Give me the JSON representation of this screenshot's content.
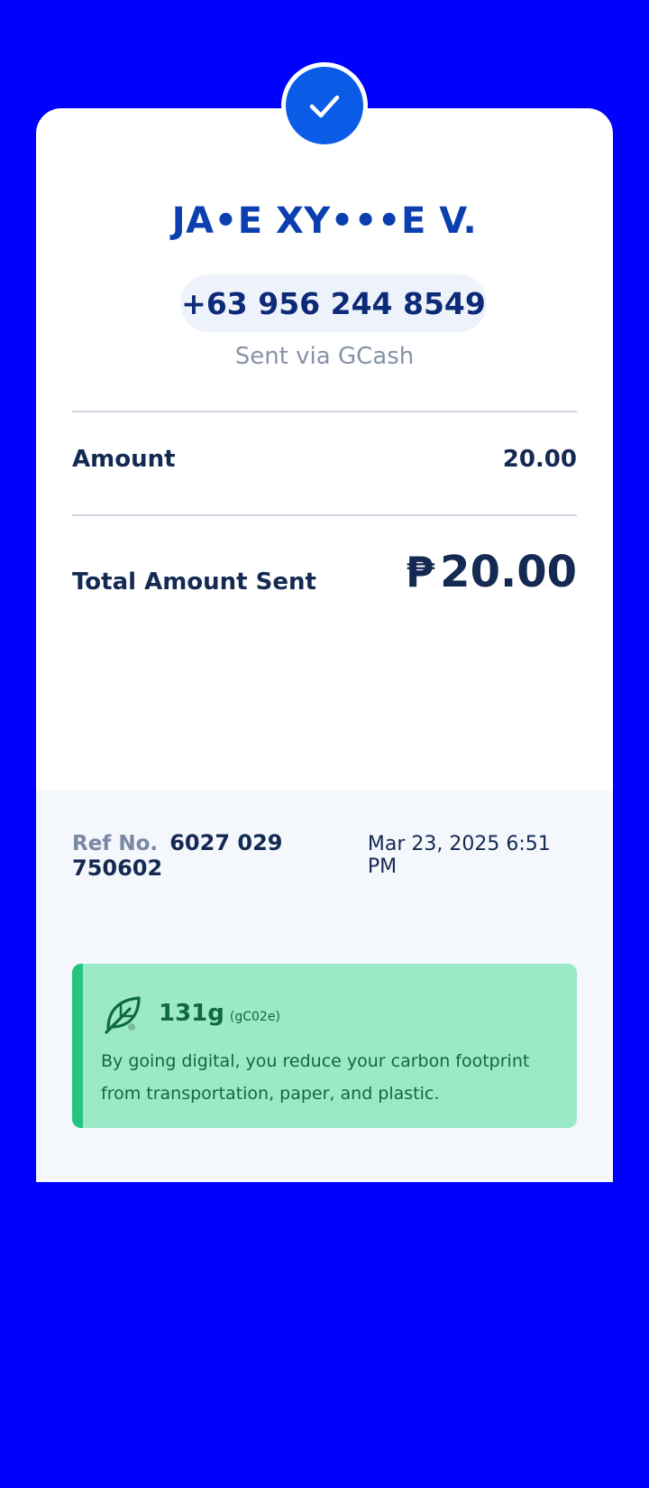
{
  "recipient": {
    "name": "JA•E XY•••E V.",
    "phone": "+63 956 244 8549",
    "sent_via": "Sent via GCash"
  },
  "status_icon": "check-icon",
  "amount": {
    "label": "Amount",
    "value": "20.00"
  },
  "total": {
    "label": "Total Amount Sent",
    "currency_symbol": "₱",
    "value": "20.00"
  },
  "reference": {
    "label": "Ref No.",
    "number": "6027 029 750602",
    "datetime": "Mar 23, 2025 6:51 PM"
  },
  "eco": {
    "icon": "leaf-icon",
    "amount": "131g",
    "unit": "(gC02e)",
    "message": "By going digital, you reduce your carbon footprint from transportation, paper, and plastic."
  },
  "colors": {
    "background": "#0000fe",
    "accent": "#0a5be6",
    "eco_bg": "#9ce9c8",
    "eco_bar": "#23c47f"
  }
}
